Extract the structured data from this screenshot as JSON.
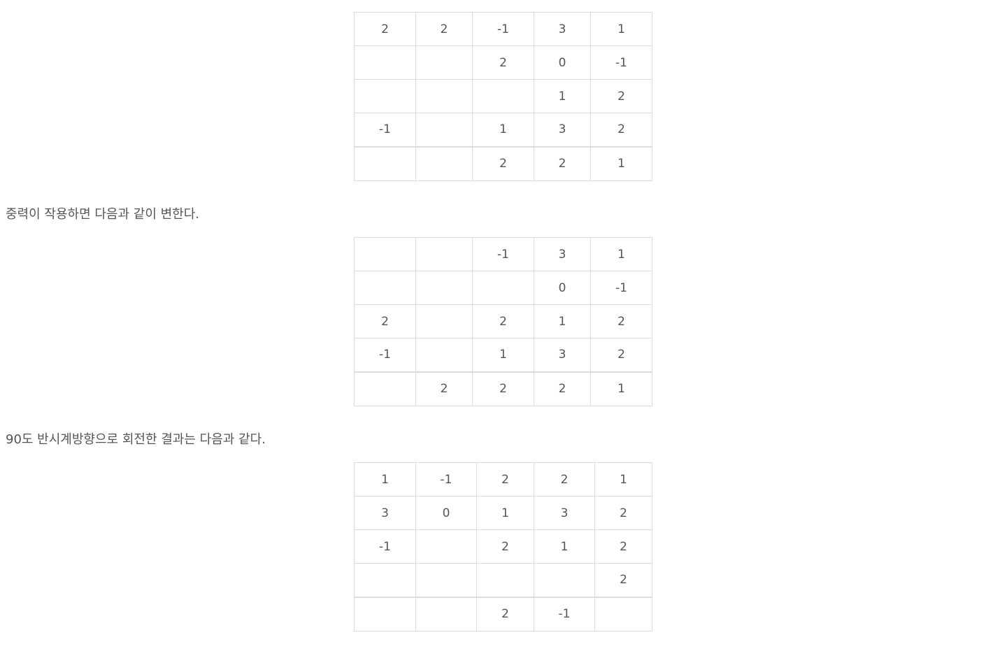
{
  "grids": [
    {
      "columns": [
        88,
        81,
        88,
        81,
        88
      ],
      "rows": [
        [
          "2",
          "2",
          "-1",
          "3",
          "1"
        ],
        [
          "",
          "",
          "2",
          "0",
          "-1"
        ],
        [
          "",
          "",
          "",
          "1",
          "2"
        ],
        [
          "-1",
          "",
          "1",
          "3",
          "2"
        ],
        [
          "",
          "",
          "2",
          "2",
          "1"
        ]
      ]
    },
    {
      "columns": [
        88,
        81,
        88,
        81,
        88
      ],
      "rows": [
        [
          "",
          "",
          "-1",
          "3",
          "1"
        ],
        [
          "",
          "",
          "",
          "0",
          "-1"
        ],
        [
          "2",
          "",
          "2",
          "1",
          "2"
        ],
        [
          "-1",
          "",
          "1",
          "3",
          "2"
        ],
        [
          "",
          "2",
          "2",
          "2",
          "1"
        ]
      ]
    },
    {
      "columns": [
        88,
        87,
        82,
        87,
        82
      ],
      "rows": [
        [
          "1",
          "-1",
          "2",
          "2",
          "1"
        ],
        [
          "3",
          "0",
          "1",
          "3",
          "2"
        ],
        [
          "-1",
          "",
          "2",
          "1",
          "2"
        ],
        [
          "",
          "",
          "",
          "",
          "2"
        ],
        [
          "",
          "",
          "2",
          "-1",
          ""
        ]
      ]
    }
  ],
  "captions": {
    "after_gravity": "중력이 작용하면 다음과 같이 변한다.",
    "after_rotation": "90도 반시계방향으로 회전한 결과는 다음과 같다."
  }
}
